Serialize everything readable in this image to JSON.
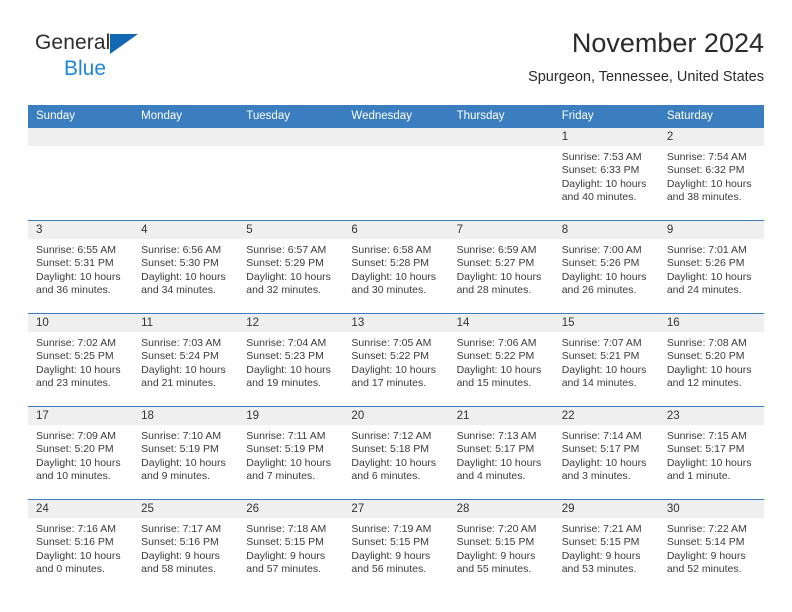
{
  "brand": {
    "line1": "General",
    "line2": "Blue",
    "triangle_color": "#1268b3",
    "blue_text_color": "#1f86d8"
  },
  "header": {
    "title": "November 2024",
    "subtitle": "Spurgeon, Tennessee, United States"
  },
  "colors": {
    "header_blue": "#3a7ec0",
    "daynum_band": "#efefef",
    "text": "#3b3b3b"
  },
  "weekdays": [
    "Sunday",
    "Monday",
    "Tuesday",
    "Wednesday",
    "Thursday",
    "Friday",
    "Saturday"
  ],
  "weeks": [
    [
      {
        "day": "",
        "empty": true
      },
      {
        "day": "",
        "empty": true
      },
      {
        "day": "",
        "empty": true
      },
      {
        "day": "",
        "empty": true
      },
      {
        "day": "",
        "empty": true
      },
      {
        "day": "1",
        "sunrise": "Sunrise: 7:53 AM",
        "sunset": "Sunset: 6:33 PM",
        "daylight1": "Daylight: 10 hours",
        "daylight2": "and 40 minutes."
      },
      {
        "day": "2",
        "sunrise": "Sunrise: 7:54 AM",
        "sunset": "Sunset: 6:32 PM",
        "daylight1": "Daylight: 10 hours",
        "daylight2": "and 38 minutes."
      }
    ],
    [
      {
        "day": "3",
        "sunrise": "Sunrise: 6:55 AM",
        "sunset": "Sunset: 5:31 PM",
        "daylight1": "Daylight: 10 hours",
        "daylight2": "and 36 minutes."
      },
      {
        "day": "4",
        "sunrise": "Sunrise: 6:56 AM",
        "sunset": "Sunset: 5:30 PM",
        "daylight1": "Daylight: 10 hours",
        "daylight2": "and 34 minutes."
      },
      {
        "day": "5",
        "sunrise": "Sunrise: 6:57 AM",
        "sunset": "Sunset: 5:29 PM",
        "daylight1": "Daylight: 10 hours",
        "daylight2": "and 32 minutes."
      },
      {
        "day": "6",
        "sunrise": "Sunrise: 6:58 AM",
        "sunset": "Sunset: 5:28 PM",
        "daylight1": "Daylight: 10 hours",
        "daylight2": "and 30 minutes."
      },
      {
        "day": "7",
        "sunrise": "Sunrise: 6:59 AM",
        "sunset": "Sunset: 5:27 PM",
        "daylight1": "Daylight: 10 hours",
        "daylight2": "and 28 minutes."
      },
      {
        "day": "8",
        "sunrise": "Sunrise: 7:00 AM",
        "sunset": "Sunset: 5:26 PM",
        "daylight1": "Daylight: 10 hours",
        "daylight2": "and 26 minutes."
      },
      {
        "day": "9",
        "sunrise": "Sunrise: 7:01 AM",
        "sunset": "Sunset: 5:26 PM",
        "daylight1": "Daylight: 10 hours",
        "daylight2": "and 24 minutes."
      }
    ],
    [
      {
        "day": "10",
        "sunrise": "Sunrise: 7:02 AM",
        "sunset": "Sunset: 5:25 PM",
        "daylight1": "Daylight: 10 hours",
        "daylight2": "and 23 minutes."
      },
      {
        "day": "11",
        "sunrise": "Sunrise: 7:03 AM",
        "sunset": "Sunset: 5:24 PM",
        "daylight1": "Daylight: 10 hours",
        "daylight2": "and 21 minutes."
      },
      {
        "day": "12",
        "sunrise": "Sunrise: 7:04 AM",
        "sunset": "Sunset: 5:23 PM",
        "daylight1": "Daylight: 10 hours",
        "daylight2": "and 19 minutes."
      },
      {
        "day": "13",
        "sunrise": "Sunrise: 7:05 AM",
        "sunset": "Sunset: 5:22 PM",
        "daylight1": "Daylight: 10 hours",
        "daylight2": "and 17 minutes."
      },
      {
        "day": "14",
        "sunrise": "Sunrise: 7:06 AM",
        "sunset": "Sunset: 5:22 PM",
        "daylight1": "Daylight: 10 hours",
        "daylight2": "and 15 minutes."
      },
      {
        "day": "15",
        "sunrise": "Sunrise: 7:07 AM",
        "sunset": "Sunset: 5:21 PM",
        "daylight1": "Daylight: 10 hours",
        "daylight2": "and 14 minutes."
      },
      {
        "day": "16",
        "sunrise": "Sunrise: 7:08 AM",
        "sunset": "Sunset: 5:20 PM",
        "daylight1": "Daylight: 10 hours",
        "daylight2": "and 12 minutes."
      }
    ],
    [
      {
        "day": "17",
        "sunrise": "Sunrise: 7:09 AM",
        "sunset": "Sunset: 5:20 PM",
        "daylight1": "Daylight: 10 hours",
        "daylight2": "and 10 minutes."
      },
      {
        "day": "18",
        "sunrise": "Sunrise: 7:10 AM",
        "sunset": "Sunset: 5:19 PM",
        "daylight1": "Daylight: 10 hours",
        "daylight2": "and 9 minutes."
      },
      {
        "day": "19",
        "sunrise": "Sunrise: 7:11 AM",
        "sunset": "Sunset: 5:19 PM",
        "daylight1": "Daylight: 10 hours",
        "daylight2": "and 7 minutes."
      },
      {
        "day": "20",
        "sunrise": "Sunrise: 7:12 AM",
        "sunset": "Sunset: 5:18 PM",
        "daylight1": "Daylight: 10 hours",
        "daylight2": "and 6 minutes."
      },
      {
        "day": "21",
        "sunrise": "Sunrise: 7:13 AM",
        "sunset": "Sunset: 5:17 PM",
        "daylight1": "Daylight: 10 hours",
        "daylight2": "and 4 minutes."
      },
      {
        "day": "22",
        "sunrise": "Sunrise: 7:14 AM",
        "sunset": "Sunset: 5:17 PM",
        "daylight1": "Daylight: 10 hours",
        "daylight2": "and 3 minutes."
      },
      {
        "day": "23",
        "sunrise": "Sunrise: 7:15 AM",
        "sunset": "Sunset: 5:17 PM",
        "daylight1": "Daylight: 10 hours",
        "daylight2": "and 1 minute."
      }
    ],
    [
      {
        "day": "24",
        "sunrise": "Sunrise: 7:16 AM",
        "sunset": "Sunset: 5:16 PM",
        "daylight1": "Daylight: 10 hours",
        "daylight2": "and 0 minutes."
      },
      {
        "day": "25",
        "sunrise": "Sunrise: 7:17 AM",
        "sunset": "Sunset: 5:16 PM",
        "daylight1": "Daylight: 9 hours",
        "daylight2": "and 58 minutes."
      },
      {
        "day": "26",
        "sunrise": "Sunrise: 7:18 AM",
        "sunset": "Sunset: 5:15 PM",
        "daylight1": "Daylight: 9 hours",
        "daylight2": "and 57 minutes."
      },
      {
        "day": "27",
        "sunrise": "Sunrise: 7:19 AM",
        "sunset": "Sunset: 5:15 PM",
        "daylight1": "Daylight: 9 hours",
        "daylight2": "and 56 minutes."
      },
      {
        "day": "28",
        "sunrise": "Sunrise: 7:20 AM",
        "sunset": "Sunset: 5:15 PM",
        "daylight1": "Daylight: 9 hours",
        "daylight2": "and 55 minutes."
      },
      {
        "day": "29",
        "sunrise": "Sunrise: 7:21 AM",
        "sunset": "Sunset: 5:15 PM",
        "daylight1": "Daylight: 9 hours",
        "daylight2": "and 53 minutes."
      },
      {
        "day": "30",
        "sunrise": "Sunrise: 7:22 AM",
        "sunset": "Sunset: 5:14 PM",
        "daylight1": "Daylight: 9 hours",
        "daylight2": "and 52 minutes."
      }
    ]
  ]
}
